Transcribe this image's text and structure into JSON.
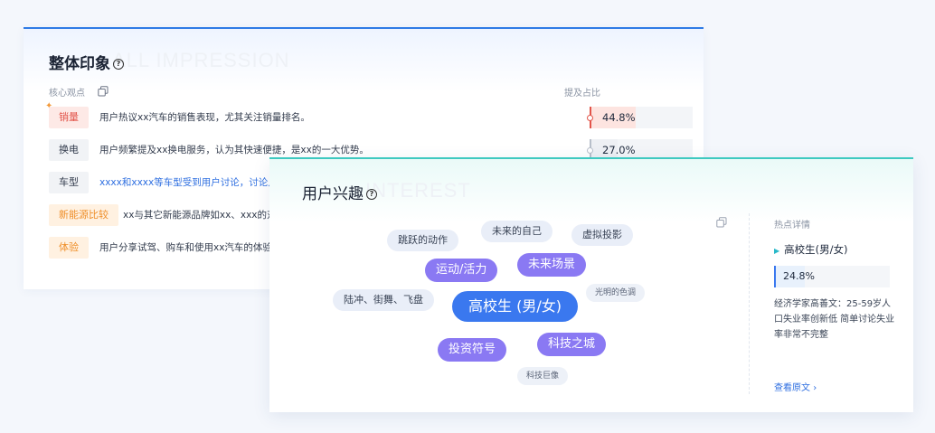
{
  "impression": {
    "title": "整体印象",
    "watermark": "ALL IMPRESSION",
    "col_view": "核心观点",
    "col_ratio": "提及占比",
    "rows": [
      {
        "tag": "销量",
        "text": "用户热议xx汽车的销售表现，尤其关注销量排名。",
        "ratio": "44.8%",
        "fraction": 0.448,
        "color": "red"
      },
      {
        "tag": "换电",
        "text": "用户频繁提及xx换电服务，认为其快速便捷，是xx的一大优势。",
        "ratio": "27.0%",
        "fraction": 0.27,
        "color": "gray"
      },
      {
        "tag": "车型",
        "text": "xxxx和xxxx等车型受到用户讨论，讨论点包括",
        "ratio": "",
        "color": "gray"
      },
      {
        "tag": "新能源比较",
        "text": "xx与其它新能源品牌如xx、xxx的对比",
        "ratio": "",
        "color": "orange"
      },
      {
        "tag": "体验",
        "text": "用户分享试驾、购车和使用xx汽车的体验，",
        "ratio": "",
        "color": "orange"
      }
    ]
  },
  "interest": {
    "title": "用户兴趣",
    "watermark": "INTEREST",
    "bubbles": [
      {
        "text": "跳跃的动作",
        "size": "sm"
      },
      {
        "text": "未来的自己",
        "size": "sm"
      },
      {
        "text": "虚拟投影",
        "size": "sm"
      },
      {
        "text": "运动/活力",
        "size": "md"
      },
      {
        "text": "未来场景",
        "size": "md"
      },
      {
        "text": "陆冲、街舞、飞盘",
        "size": "sm"
      },
      {
        "text": "高校生 (男/女)",
        "size": "lg"
      },
      {
        "text": "光明的色调",
        "size": "xs"
      },
      {
        "text": "投资符号",
        "size": "md"
      },
      {
        "text": "科技之城",
        "size": "md"
      },
      {
        "text": "科技巨像",
        "size": "xs"
      }
    ],
    "detail": {
      "label": "热点详情",
      "selected": "高校生(男/女)",
      "percent": "24.8%",
      "fraction": 0.248,
      "description": "经济学家高善文：25-59岁人口失业率创新低 简单讨论失业率非常不完整",
      "link": "查看原文"
    }
  },
  "colors": {
    "blue_accent": "#2f7be5",
    "teal_accent": "#3ec9c0",
    "purple_bubble": "#8a79f3",
    "blue_bubble": "#3a78ef",
    "red_tag": "#f26b5b",
    "orange_tag": "#f39a3a"
  }
}
